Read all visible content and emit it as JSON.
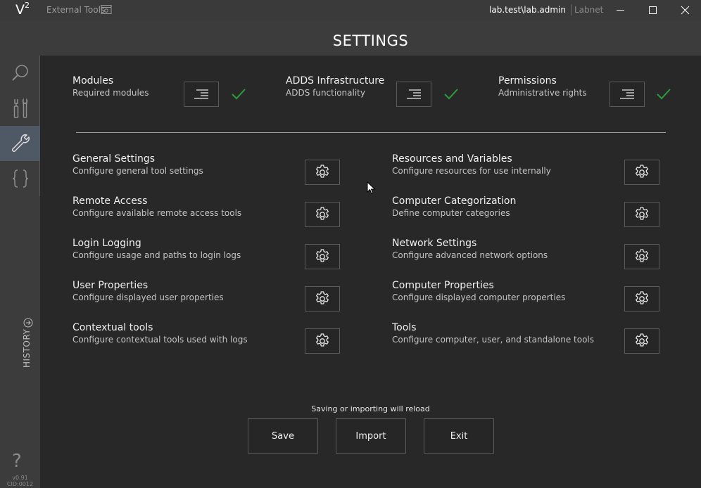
{
  "titlebar": {
    "logo": "V",
    "logo_sup": "2",
    "external_tools": "External Tools",
    "user": "lab.test\\lab.admin",
    "domain": "Labnet"
  },
  "sidebar": {
    "items": [
      {
        "name": "search",
        "icon": "search-icon"
      },
      {
        "name": "tools",
        "icon": "tools-icon"
      },
      {
        "name": "settings",
        "icon": "wrench-icon",
        "active": true
      },
      {
        "name": "scripts",
        "icon": "braces-icon"
      }
    ],
    "history_label": "HISTORY",
    "help": "?",
    "version": "v0.91",
    "cid": "CID:0012"
  },
  "header": {
    "title": "SETTINGS"
  },
  "prerequisites": [
    {
      "title": "Modules",
      "subtitle": "Required modules",
      "status": "ok"
    },
    {
      "title": "ADDS Infrastructure",
      "subtitle": "ADDS functionality",
      "status": "ok"
    },
    {
      "title": "Permissions",
      "subtitle": "Administrative rights",
      "status": "ok"
    }
  ],
  "settings_left": [
    {
      "title": "General Settings",
      "subtitle": "Configure general tool settings"
    },
    {
      "title": "Remote Access",
      "subtitle": "Configure available remote access tools"
    },
    {
      "title": "Login Logging",
      "subtitle": "Configure usage and paths to login logs"
    },
    {
      "title": "User Properties",
      "subtitle": "Configure displayed user properties"
    },
    {
      "title": "Contextual tools",
      "subtitle": "Configure contextual tools used with logs"
    }
  ],
  "settings_right": [
    {
      "title": "Resources and Variables",
      "subtitle": "Configure resources for use internally"
    },
    {
      "title": "Computer Categorization",
      "subtitle": "Define computer categories"
    },
    {
      "title": "Network Settings",
      "subtitle": "Configure advanced network options"
    },
    {
      "title": "Computer Properties",
      "subtitle": "Configure displayed computer properties"
    },
    {
      "title": "Tools",
      "subtitle": "Configure computer, user, and standalone tools"
    }
  ],
  "footer": {
    "note": "Saving or importing will reload",
    "save_label": "Save",
    "import_label": "Import",
    "exit_label": "Exit"
  },
  "colors": {
    "check": "#2e9a3c",
    "active_nav": "#4f5865"
  }
}
